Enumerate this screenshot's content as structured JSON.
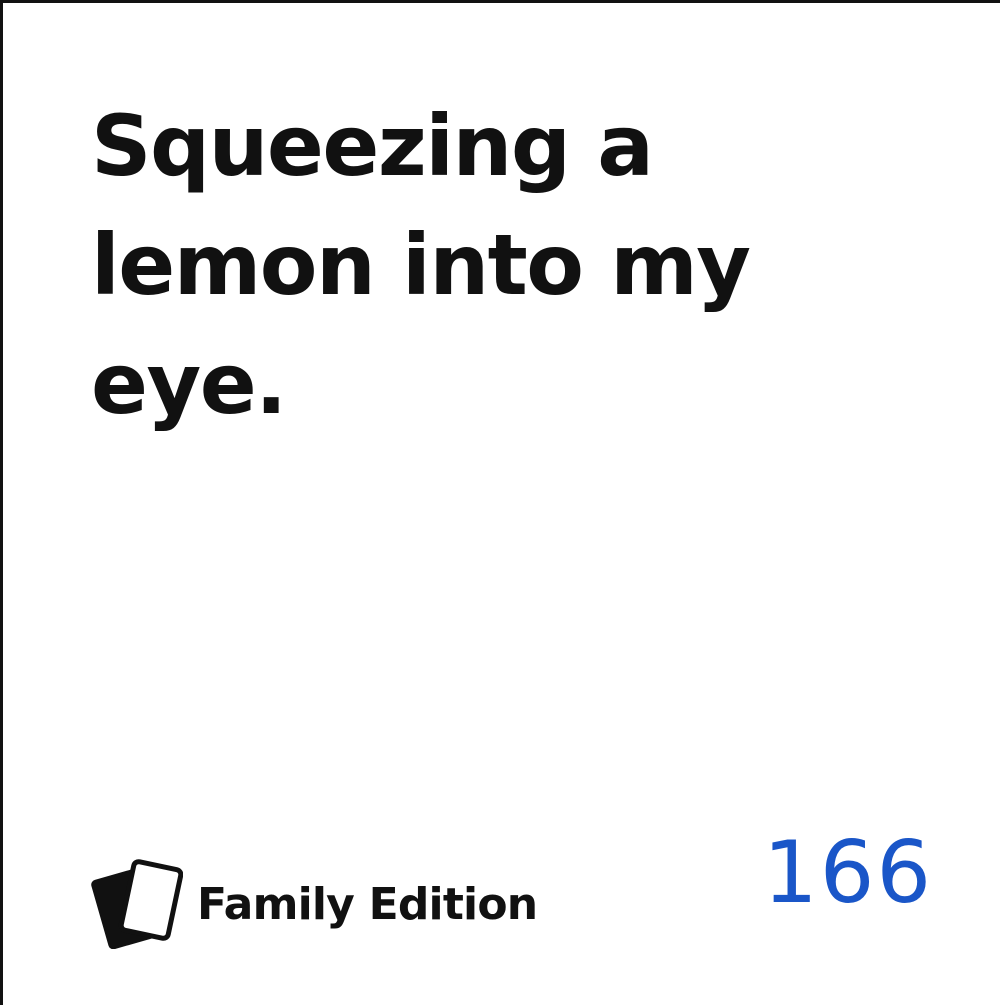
{
  "card": {
    "text": "Squeezing a lemon into my eye.",
    "edition": "Family Edition",
    "number": "166",
    "number_color": "#1a56c8",
    "logo_icon": "stacked-cards-icon"
  }
}
